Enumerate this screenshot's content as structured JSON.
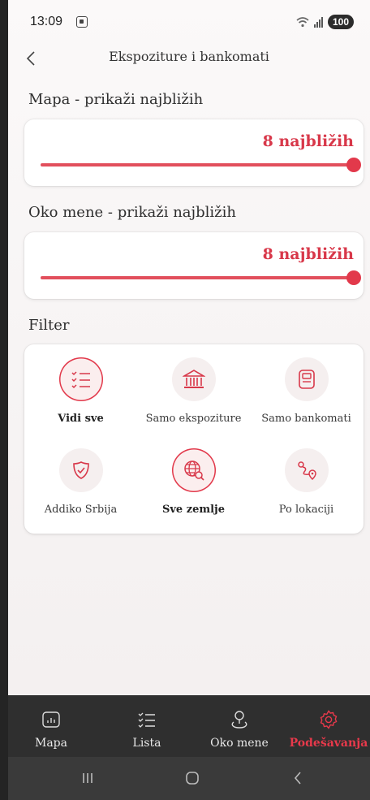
{
  "status_bar": {
    "time": "13:09",
    "battery": "100"
  },
  "header": {
    "title": "Ekspoziture i bankomati"
  },
  "map_section": {
    "label": "Mapa - prikaži najbližih",
    "value_text": "8 najbližih",
    "slider_fraction": 1.0
  },
  "around_section": {
    "label": "Oko mene - prikaži najbližih",
    "value_text": "8 najbližih",
    "slider_fraction": 1.0
  },
  "filter": {
    "label": "Filter",
    "items": [
      {
        "label": "Vidi sve",
        "icon": "list-check-icon",
        "active": true
      },
      {
        "label": "Samo ekspoziture",
        "icon": "bank-icon",
        "active": false
      },
      {
        "label": "Samo bankomati",
        "icon": "atm-icon",
        "active": false
      },
      {
        "label": "Addiko Srbija",
        "icon": "shield-check-icon",
        "active": false
      },
      {
        "label": "Sve zemlje",
        "icon": "globe-search-icon",
        "active": true
      },
      {
        "label": "Po lokaciji",
        "icon": "route-pin-icon",
        "active": false
      }
    ]
  },
  "bottom_nav": {
    "items": [
      {
        "label": "Mapa",
        "icon": "map-icon",
        "active": false
      },
      {
        "label": "Lista",
        "icon": "list-icon",
        "active": false
      },
      {
        "label": "Oko mene",
        "icon": "location-person-icon",
        "active": false
      },
      {
        "label": "Podešavanja",
        "icon": "settings-icon",
        "active": true
      }
    ]
  },
  "colors": {
    "accent": "#e2394b",
    "nav_background": "#2f2f2f"
  }
}
